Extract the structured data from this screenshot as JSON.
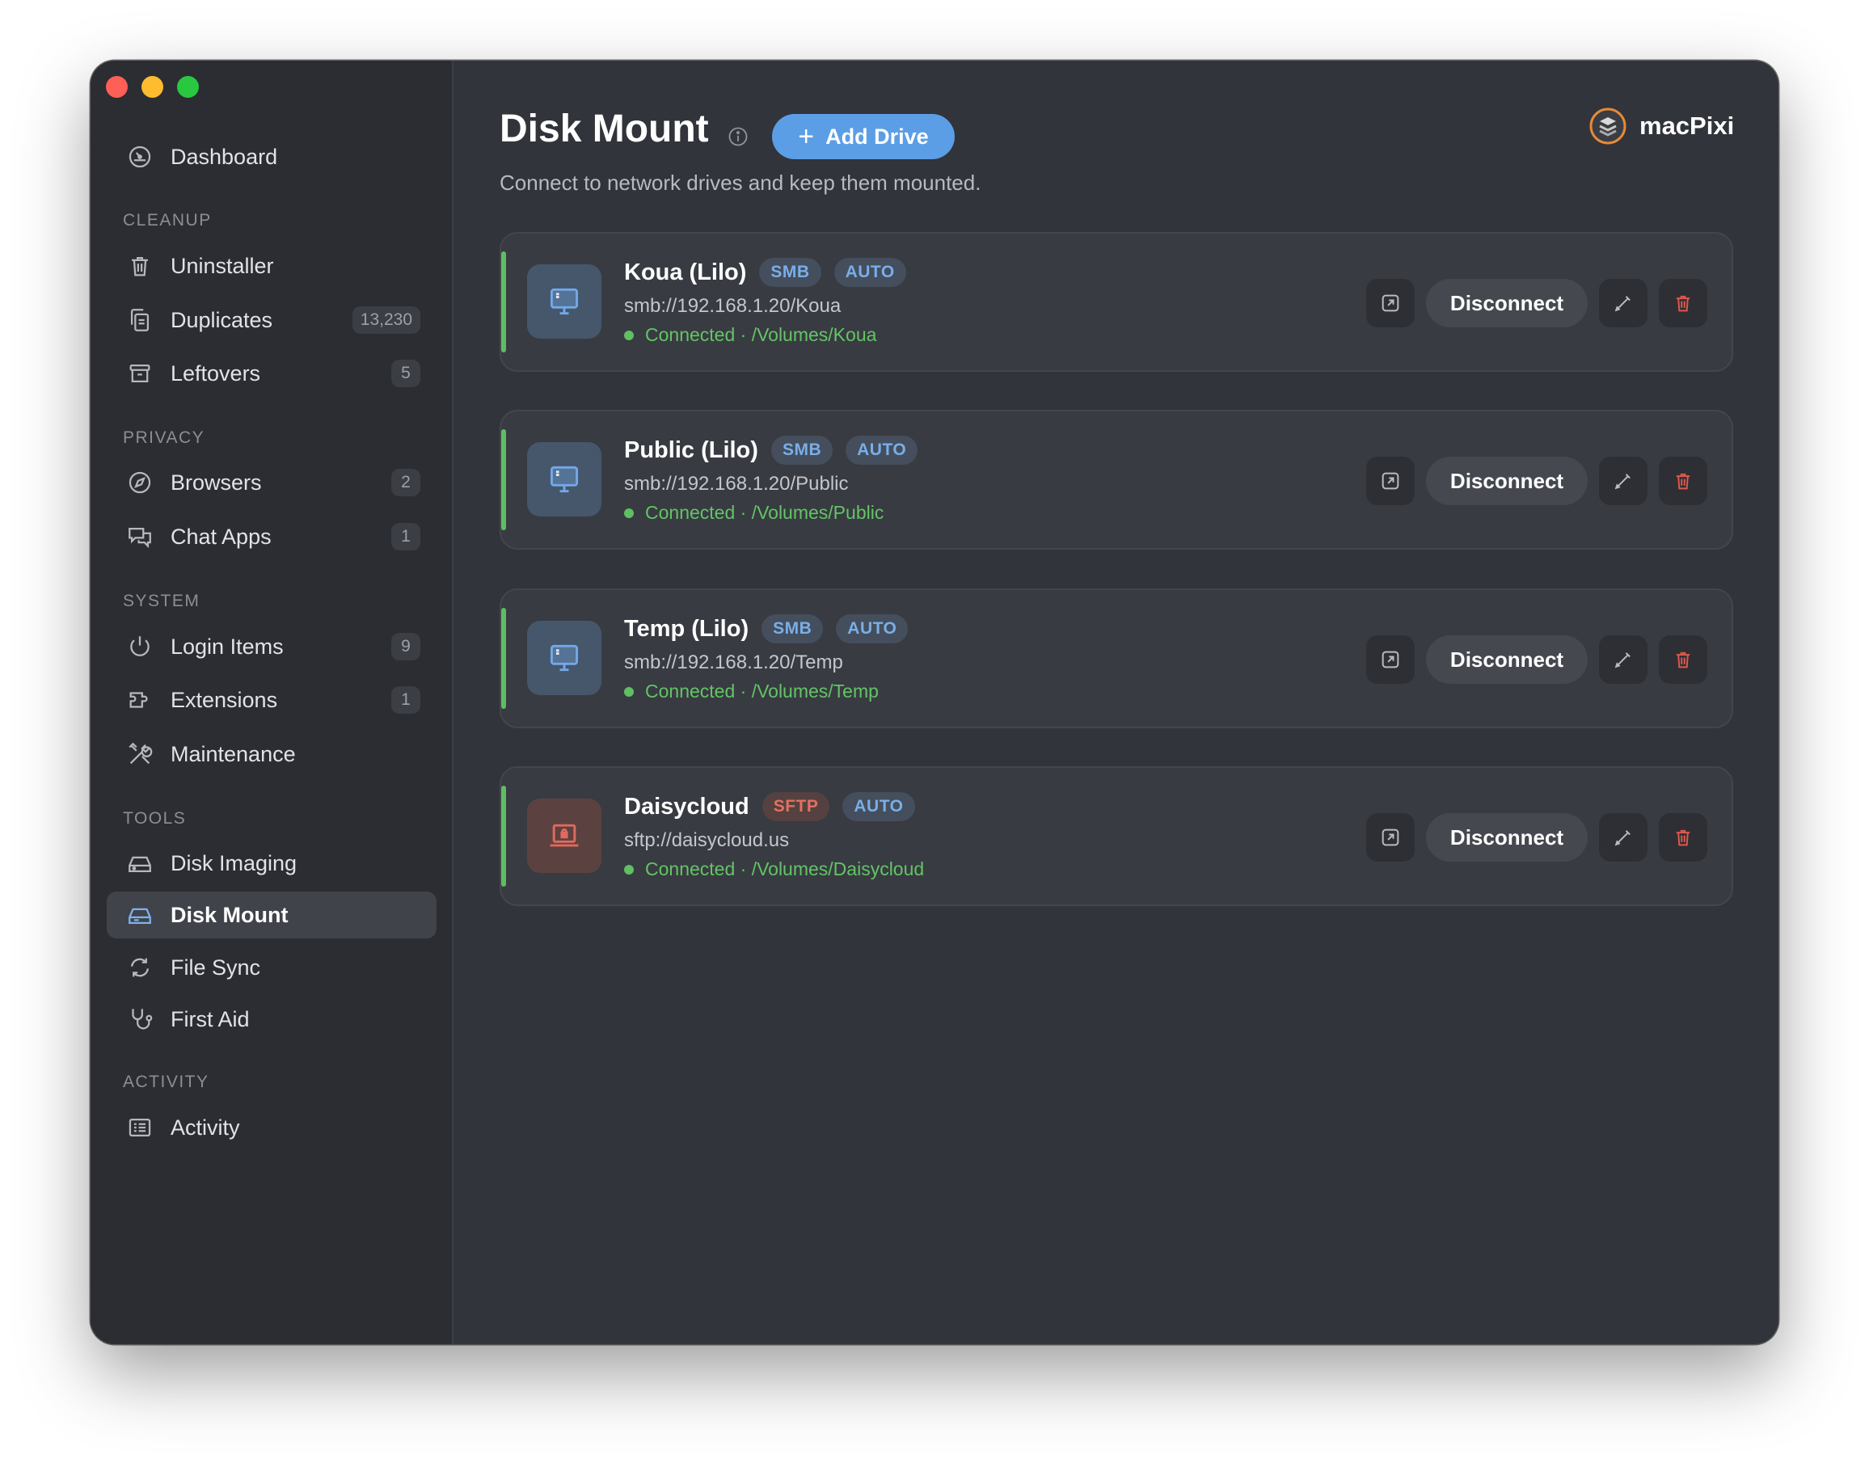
{
  "sidebar": {
    "dashboard": "Dashboard",
    "sections": {
      "cleanup": "CLEANUP",
      "privacy": "PRIVACY",
      "system": "SYSTEM",
      "tools": "TOOLS",
      "activity": "ACTIVITY"
    },
    "items": {
      "uninstaller": {
        "label": "Uninstaller",
        "icon": "trash-icon"
      },
      "duplicates": {
        "label": "Duplicates",
        "count": "13,230",
        "icon": "copy-icon"
      },
      "leftovers": {
        "label": "Leftovers",
        "count": "5",
        "icon": "archive-icon"
      },
      "browsers": {
        "label": "Browsers",
        "count": "2",
        "icon": "compass-icon"
      },
      "chat_apps": {
        "label": "Chat Apps",
        "count": "1",
        "icon": "chat-icon"
      },
      "login_items": {
        "label": "Login Items",
        "count": "9",
        "icon": "power-icon"
      },
      "extensions": {
        "label": "Extensions",
        "count": "1",
        "icon": "extension-icon"
      },
      "maintenance": {
        "label": "Maintenance",
        "icon": "tools-icon"
      },
      "disk_imaging": {
        "label": "Disk Imaging",
        "icon": "disk-icon"
      },
      "disk_mount": {
        "label": "Disk Mount",
        "icon": "disk-mount-icon",
        "active": true
      },
      "file_sync": {
        "label": "File Sync",
        "icon": "sync-icon"
      },
      "first_aid": {
        "label": "First Aid",
        "icon": "stethoscope-icon"
      },
      "activity": {
        "label": "Activity",
        "icon": "list-icon"
      }
    }
  },
  "header": {
    "title": "Disk Mount",
    "add_button": "Add Drive",
    "subtitle": "Connect to network drives and keep them mounted.",
    "brand": "macPixi"
  },
  "drives": [
    {
      "name": "Koua (Lilo)",
      "protocol": "SMB",
      "mode": "AUTO",
      "url": "smb://192.168.1.20/Koua",
      "status": "Connected · /Volumes/Koua",
      "disconnect": "Disconnect"
    },
    {
      "name": "Public (Lilo)",
      "protocol": "SMB",
      "mode": "AUTO",
      "url": "smb://192.168.1.20/Public",
      "status": "Connected · /Volumes/Public",
      "disconnect": "Disconnect"
    },
    {
      "name": "Temp (Lilo)",
      "protocol": "SMB",
      "mode": "AUTO",
      "url": "smb://192.168.1.20/Temp",
      "status": "Connected · /Volumes/Temp",
      "disconnect": "Disconnect"
    },
    {
      "name": "Daisycloud",
      "protocol": "SFTP",
      "mode": "AUTO",
      "url": "sftp://daisycloud.us",
      "status": "Connected · /Volumes/Daisycloud",
      "disconnect": "Disconnect"
    }
  ],
  "colors": {
    "accent": "#5b9ee6",
    "connected": "#5fbd61",
    "danger": "#e0584c",
    "window_bg": "#31343a",
    "sidebar_bg": "#2b2d32"
  }
}
